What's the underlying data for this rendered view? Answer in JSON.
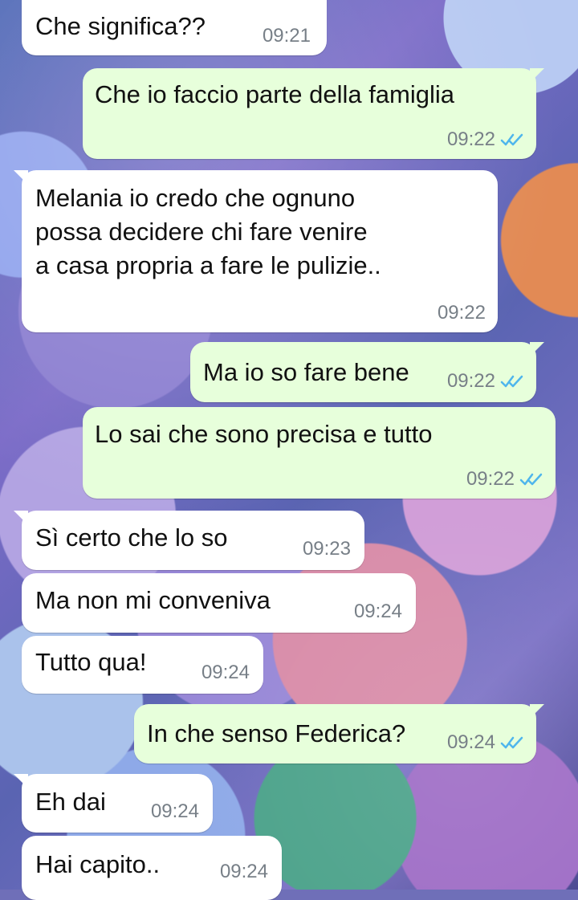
{
  "conversation": {
    "messages": [
      {
        "text": "Che significa??",
        "time": "09:21"
      },
      {
        "text": "Che io faccio parte della famiglia",
        "time": "09:22",
        "read": true
      },
      {
        "text": "Melania io credo che ognuno\npossa decidere chi fare venire\na casa propria a fare le pulizie..",
        "time": "09:22"
      },
      {
        "text": "Ma io so fare bene",
        "time": "09:22",
        "read": true
      },
      {
        "text": "Lo sai che sono precisa e tutto",
        "time": "09:22",
        "read": true
      },
      {
        "text": "Sì certo che lo so",
        "time": "09:23"
      },
      {
        "text": "Ma non mi conveniva",
        "time": "09:24"
      },
      {
        "text": "Tutto qua!",
        "time": "09:24"
      },
      {
        "text": "In che senso Federica?",
        "time": "09:24",
        "read": true
      },
      {
        "text": "Eh dai",
        "time": "09:24"
      },
      {
        "text": "Hai capito..",
        "time": "09:24"
      }
    ]
  },
  "icons": {
    "read_receipt": "double-check-icon"
  },
  "colors": {
    "incoming_bubble": "#ffffff",
    "outgoing_bubble": "#e7ffdb",
    "read_receipt": "#4fb6ec",
    "timestamp": "#777f87"
  }
}
